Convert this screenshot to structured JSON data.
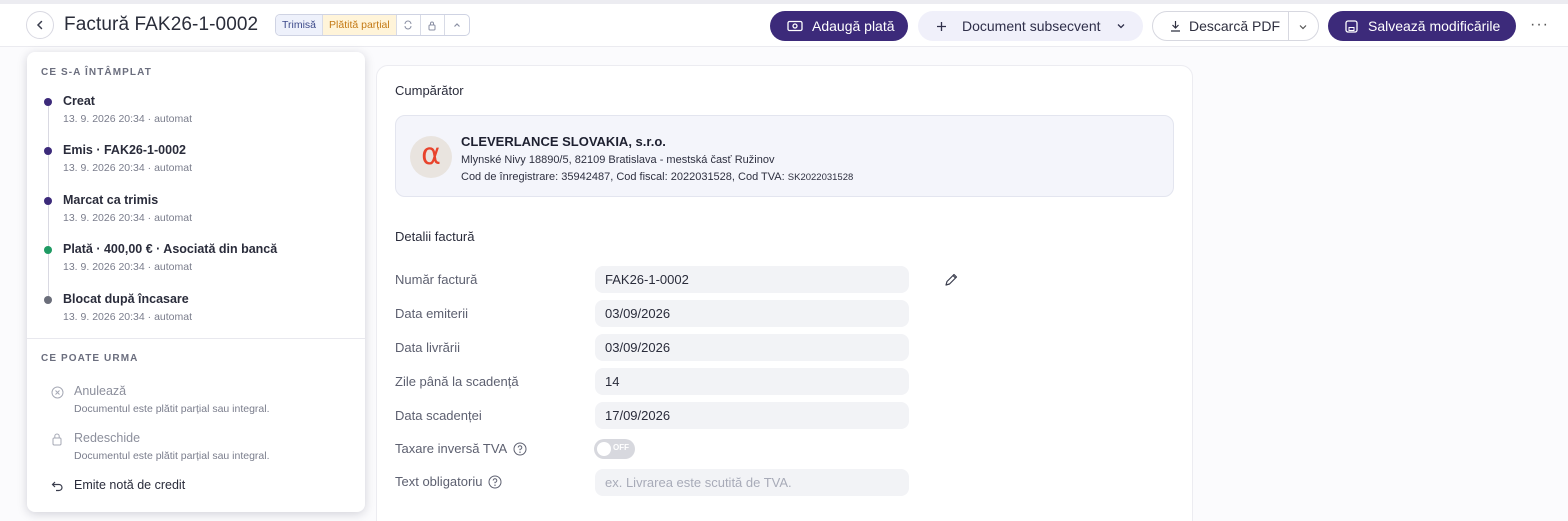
{
  "header": {
    "title": "Factură FAK26-1-0002",
    "badge_sent": "Trimisă",
    "badge_partial": "Plătită parțial",
    "add_payment": "Adaugă plată",
    "subsequent_doc": "Document subsecvent",
    "download_pdf": "Descarcă PDF",
    "save_changes": "Salvează modificările",
    "more": "···"
  },
  "history": {
    "title": "CE S-A ÎNTÂMPLAT",
    "items": [
      {
        "title": "Creat",
        "meta": "13. 9. 2026 20:34 · automat",
        "color": "#3c2a7a"
      },
      {
        "title": "Emis · FAK26-1-0002",
        "meta": "13. 9. 2026 20:34 · automat",
        "color": "#3c2a7a"
      },
      {
        "title": "Marcat ca trimis",
        "meta": "13. 9. 2026 20:34 · automat",
        "color": "#3c2a7a"
      },
      {
        "title": "Plată · 400,00 € · Asociată din bancă",
        "meta": "13. 9. 2026 20:34 · automat",
        "color": "#1f9a63"
      },
      {
        "title": "Blocat după încasare",
        "meta": "13. 9. 2026 20:34 · automat",
        "color": "#6b6e7a"
      }
    ]
  },
  "next": {
    "title": "CE POATE URMA",
    "actions": [
      {
        "title": "Anulează",
        "desc": "Documentul este plătit parțial sau integral.",
        "icon": "cancel-circle-icon"
      },
      {
        "title": "Redeschide",
        "desc": "Documentul este plătit parțial sau integral.",
        "icon": "lock-icon"
      },
      {
        "title": "Emite notă de credit",
        "desc": "",
        "icon": "undo-arrow-icon"
      }
    ]
  },
  "buyer": {
    "section_label": "Cumpărător",
    "name": "CLEVERLANCE SLOVAKIA, s.r.o.",
    "address": "Mlynské Nivy 18890/5, 82109 Bratislava - mestská časť Ružinov",
    "codes": "Cod de înregistrare: 35942487, Cod fiscal: 2022031528, Cod TVA:",
    "vat_code": "SK2022031528",
    "logo_letter": "α",
    "logo_color": "#e8432c"
  },
  "details": {
    "section_label": "Detalii factură",
    "fields": [
      {
        "label": "Număr factură",
        "value": "FAK26-1-0002"
      },
      {
        "label": "Data emiterii",
        "value": "03/09/2026"
      },
      {
        "label": "Data livrării",
        "value": "03/09/2026"
      },
      {
        "label": "Zile până la scadență",
        "value": "14"
      },
      {
        "label": "Data scadenței",
        "value": "17/09/2026"
      }
    ],
    "reverse_charge_label": "Taxare inversă TVA",
    "reverse_charge_toggle": "OFF",
    "mandatory_text_label": "Text obligatoriu",
    "mandatory_text_placeholder": "ex. Livrarea este scutită de TVA."
  },
  "colors": {
    "primary": "#3c2a7a",
    "soft": "#f0f0fa",
    "partial": "#c47a15"
  }
}
